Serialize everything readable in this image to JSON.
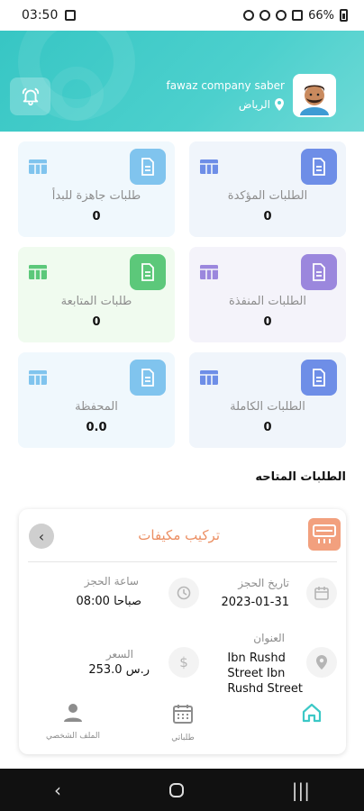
{
  "status_bar": {
    "time": "03:50",
    "battery": "66%"
  },
  "header": {
    "user_name": "fawaz company saber",
    "location": "الرياض",
    "icons": {
      "bell": "bell-icon",
      "location": "location-pin-icon"
    }
  },
  "cards": [
    {
      "title": "الطلبات المؤكدة",
      "value": "0",
      "bg": "#f0f5fb",
      "icon_bg": "#6e8ee7",
      "grid_color": "#6e8ee7"
    },
    {
      "title": "طلبات جاهزة للبدأ",
      "value": "0",
      "bg": "#f0f8fd",
      "icon_bg": "#80c4ee",
      "grid_color": "#80c4ee"
    },
    {
      "title": "الطلبات المنفذة",
      "value": "0",
      "bg": "#f4f3fa",
      "icon_bg": "#9b87dd",
      "grid_color": "#9b87dd"
    },
    {
      "title": "طلبات المتابعة",
      "value": "0",
      "bg": "#f0fbef",
      "icon_bg": "#5cc87a",
      "grid_color": "#5cc87a"
    },
    {
      "title": "الطلبات الكاملة",
      "value": "0",
      "bg": "#f0f5fb",
      "icon_bg": "#6e8ee7",
      "grid_color": "#6e8ee7"
    },
    {
      "title": "المحفظة",
      "value": "0.0",
      "bg": "#f0f8fd",
      "icon_bg": "#80c4ee",
      "grid_color": "#80c4ee"
    }
  ],
  "available_orders_title": "الطلبات المتاحه",
  "order": {
    "title": "تركيب مكيفات",
    "booking_date_label": "تاريخ الحجز",
    "booking_date": "2023-01-31",
    "booking_time_label": "ساعة الحجز",
    "booking_time": "08:00 صباحا",
    "address_label": "العنوان",
    "address_lines": [
      "Ibn Rushd",
      "Street Ibn",
      "Rushd Street"
    ],
    "price_label": "السعر",
    "price": "253.0 ر.س"
  },
  "bottom_nav": {
    "home": "",
    "my_orders": "طلباتي",
    "profile": "الملف الشخصي"
  },
  "colors": {
    "primary": "#3cc8c6",
    "accent_orange": "#ec8f63"
  }
}
